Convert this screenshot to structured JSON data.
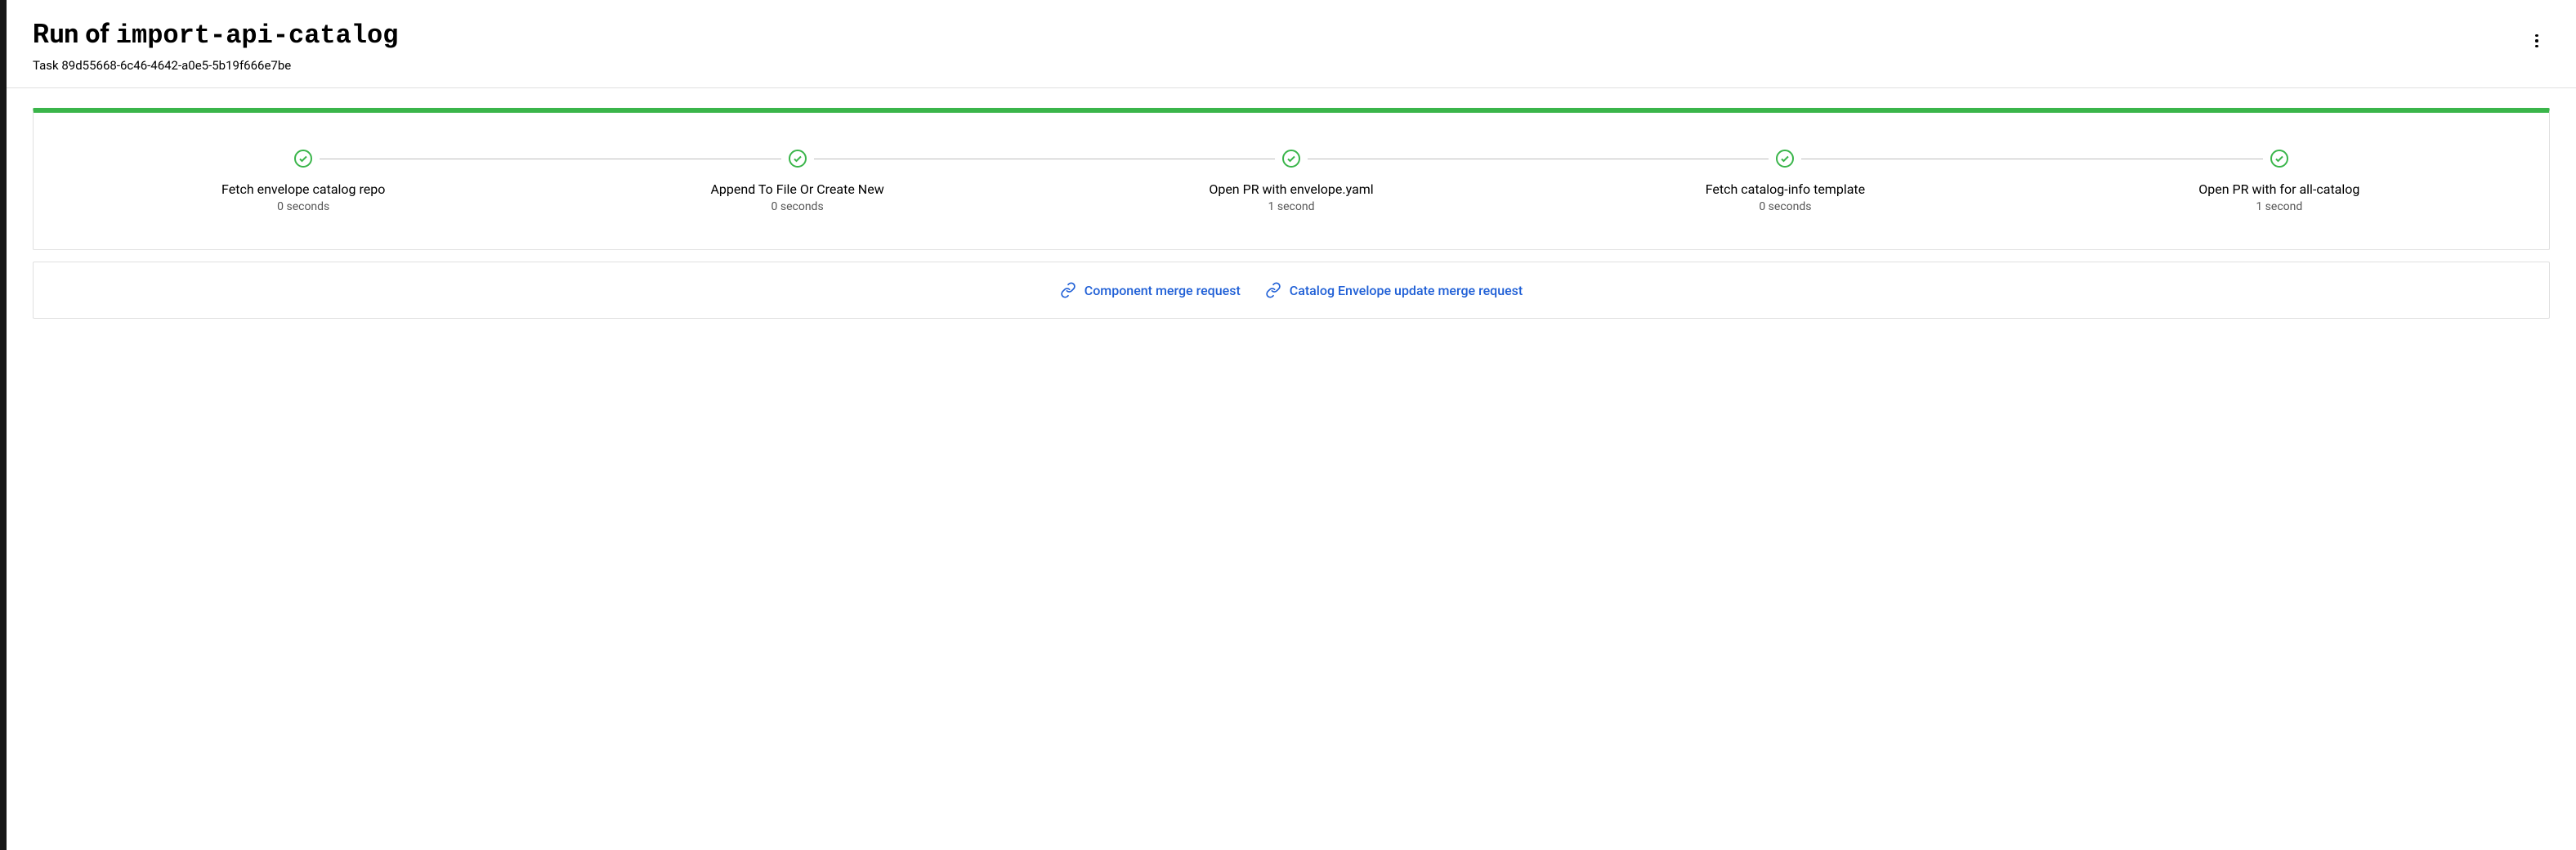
{
  "header": {
    "title_prefix": "Run of ",
    "title_code": "import-api-catalog",
    "subtitle_prefix": "Task ",
    "task_id": "89d55668-6c46-4642-a0e5-5b19f666e7be"
  },
  "steps": [
    {
      "label": "Fetch envelope catalog repo",
      "duration": "0 seconds",
      "status": "success"
    },
    {
      "label": "Append To File Or Create New",
      "duration": "0 seconds",
      "status": "success"
    },
    {
      "label": "Open PR with envelope.yaml",
      "duration": "1 second",
      "status": "success"
    },
    {
      "label": "Fetch catalog-info template",
      "duration": "0 seconds",
      "status": "success"
    },
    {
      "label": "Open PR with for all-catalog",
      "duration": "1 second",
      "status": "success"
    }
  ],
  "links": [
    {
      "label": "Component merge request"
    },
    {
      "label": "Catalog Envelope update merge request"
    }
  ],
  "colors": {
    "success_green": "#3ab54a",
    "link_blue": "#1f5fd6",
    "border_gray": "#e0e0e0"
  }
}
